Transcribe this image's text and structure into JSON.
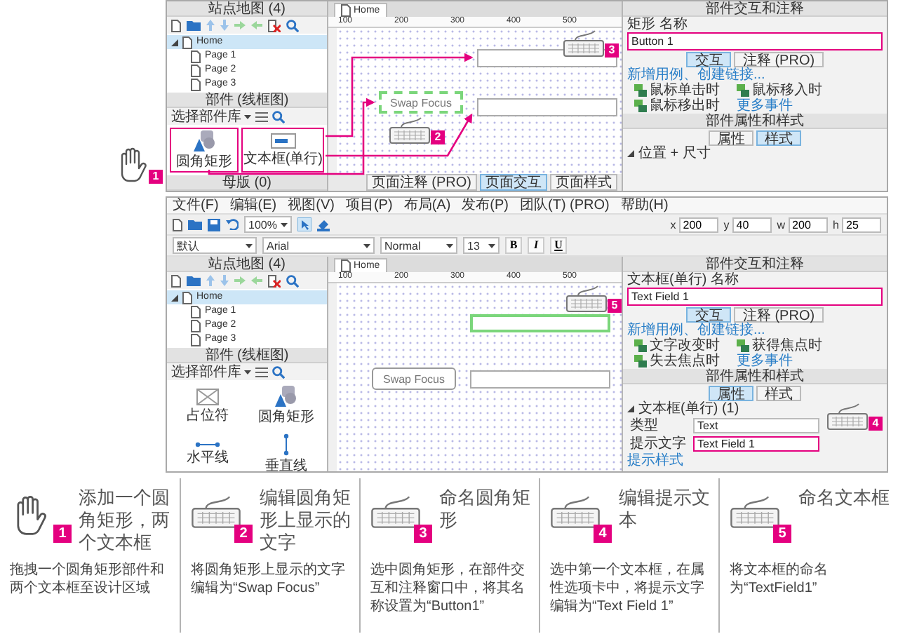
{
  "top_screenshot": {
    "sitemap": {
      "title": "站点地图 (4)",
      "pages": [
        {
          "label": "Home",
          "selected": true,
          "children": [
            {
              "label": "Page 1",
              "selected": false
            },
            {
              "label": "Page 2",
              "selected": false
            },
            {
              "label": "Page 3",
              "selected": false
            }
          ]
        }
      ]
    },
    "widgets": {
      "title": "部件 (线框图)",
      "library": "选择部件库",
      "items": [
        {
          "label": "圆角矩形",
          "kind": "rounded-rect",
          "highlighted": true
        },
        {
          "label": "文本框(单行)",
          "kind": "text-field",
          "highlighted": true
        }
      ]
    },
    "masters": {
      "title": "母版 (0)"
    },
    "canvas": {
      "tab": "Home",
      "ruler": [
        "100",
        "200",
        "300",
        "400",
        "500"
      ],
      "text_fields": [
        {
          "selected": false
        },
        {
          "selected": false
        }
      ],
      "button": {
        "label": "Swap Focus",
        "selected": true
      },
      "bottom_tabs": [
        {
          "label": "页面注释 (PRO)",
          "selected": false
        },
        {
          "label": "页面交互",
          "selected": true
        },
        {
          "label": "页面样式",
          "selected": false
        }
      ]
    },
    "interactions": {
      "title": "部件交互和注释",
      "name_label": "矩形 名称",
      "name_value": "Button 1",
      "name_highlighted": true,
      "tabs": [
        {
          "label": "交互",
          "selected": true
        },
        {
          "label": "注释 (PRO)",
          "selected": false
        }
      ],
      "link": "新增用例、创建链接...",
      "events": [
        "鼠标单击时",
        "鼠标移入时",
        "鼠标移出时"
      ],
      "more": "更多事件"
    },
    "properties": {
      "title": "部件属性和样式",
      "tabs": [
        {
          "label": "属性",
          "selected": false
        },
        {
          "label": "样式",
          "selected": true
        }
      ],
      "section": "位置 + 尺寸"
    },
    "callouts": [
      {
        "number": "1",
        "kind": "hand"
      },
      {
        "number": "2",
        "kind": "keyboard"
      },
      {
        "number": "3",
        "kind": "keyboard"
      }
    ]
  },
  "bottom_screenshot": {
    "menu": [
      "文件(F)",
      "编辑(E)",
      "视图(V)",
      "项目(P)",
      "布局(A)",
      "发布(P)",
      "团队(T) (PRO)",
      "帮助(H)"
    ],
    "toolbar": {
      "zoom": "100%",
      "style": "默认",
      "font": "Arial",
      "weight": "Normal",
      "size": "13",
      "format": [
        "B",
        "I",
        "U"
      ],
      "geometry": [
        {
          "label": "x",
          "value": "200"
        },
        {
          "label": "y",
          "value": "40"
        },
        {
          "label": "w",
          "value": "200"
        },
        {
          "label": "h",
          "value": "25"
        }
      ]
    },
    "sitemap": {
      "title": "站点地图 (4)",
      "pages": [
        {
          "label": "Home",
          "selected": true,
          "children": [
            {
              "label": "Page 1",
              "selected": false
            },
            {
              "label": "Page 2",
              "selected": false
            },
            {
              "label": "Page 3",
              "selected": false
            }
          ]
        }
      ]
    },
    "widgets": {
      "title": "部件 (线框图)",
      "library": "选择部件库",
      "items": [
        {
          "label": "占位符",
          "kind": "placeholder",
          "highlighted": false
        },
        {
          "label": "圆角矩形",
          "kind": "rounded-rect",
          "highlighted": false
        },
        {
          "label": "水平线",
          "kind": "hline",
          "highlighted": false
        },
        {
          "label": "垂直线",
          "kind": "vline",
          "highlighted": false
        }
      ]
    },
    "canvas": {
      "tab": "Home",
      "ruler": [
        "100",
        "200",
        "300",
        "400",
        "500"
      ],
      "text_fields": [
        {
          "selected": true
        },
        {
          "selected": false
        }
      ],
      "button": {
        "label": "Swap Focus",
        "selected": false
      }
    },
    "interactions": {
      "title": "部件交互和注释",
      "name_label": "文本框(单行) 名称",
      "name_value": "Text Field 1",
      "name_highlighted": true,
      "tabs": [
        {
          "label": "交互",
          "selected": true
        },
        {
          "label": "注释 (PRO)",
          "selected": false
        }
      ],
      "link": "新增用例、创建链接...",
      "events": [
        "文字改变时",
        "获得焦点时",
        "失去焦点时"
      ],
      "more": "更多事件"
    },
    "properties": {
      "title": "部件属性和样式",
      "tabs": [
        {
          "label": "属性",
          "selected": true
        },
        {
          "label": "样式",
          "selected": false
        }
      ],
      "section": "文本框(单行) (1)",
      "rows": [
        {
          "label": "类型",
          "value": "Text",
          "highlighted": false
        },
        {
          "label": "提示文字",
          "value": "Text Field 1",
          "highlighted": true
        }
      ],
      "link": "提示样式"
    },
    "callouts": [
      {
        "number": "4",
        "kind": "keyboard"
      },
      {
        "number": "5",
        "kind": "keyboard"
      }
    ]
  },
  "steps": [
    {
      "number": "1",
      "kind": "hand",
      "title": "添加一个圆角矩形，两个文本框",
      "description": "拖拽一个圆角矩形部件和两个文本框至设计区域"
    },
    {
      "number": "2",
      "kind": "keyboard",
      "title": "编辑圆角矩形上显示的文字",
      "description": "将圆角矩形上显示的文字编辑为“Swap Focus”"
    },
    {
      "number": "3",
      "kind": "keyboard",
      "title": "命名圆角矩形",
      "description": "选中圆角矩形，在部件交互和注释窗口中，将其名称设置为“Button1”"
    },
    {
      "number": "4",
      "kind": "keyboard",
      "title": "编辑提示文本",
      "description": "选中第一个文本框，在属性选项卡中，将提示文字编辑为“Text Field 1”"
    },
    {
      "number": "5",
      "kind": "keyboard",
      "title": "命名文本框",
      "description": "将文本框的命名为“TextField1”"
    }
  ]
}
